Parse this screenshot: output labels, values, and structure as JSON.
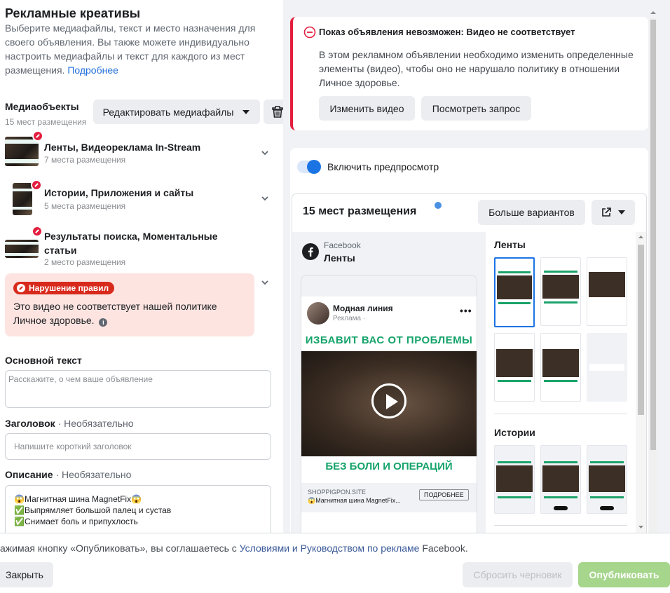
{
  "creatives": {
    "title": "Рекламные креативы",
    "intro": "Выберите медиафайлы, текст и место назначения для своего объявления. Вы также можете индивидуально настроить медиафайлы и текст для каждого из мест размещения.",
    "learn_more": "Подробнее",
    "media_label": "Медиаобъекты",
    "media_sub": "15 мест размещения",
    "edit_media": "Редактировать медиафайлы",
    "groups": [
      {
        "title": "Ленты, Видеореклама In-Stream",
        "sub": "7 места размещения"
      },
      {
        "title": "Истории, Приложения и сайты",
        "sub": "5 места размещения"
      },
      {
        "title": "Результаты поиска, Моментальные статьи",
        "sub": "2 место размещения"
      }
    ],
    "violation_badge": "Нарушение правил",
    "violation_text": "Это видео не соответствует нашей политике Личное здоровье.",
    "primary_text_label": "Основной текст",
    "primary_text_placeholder": "Расскажите, о чем ваше объявление",
    "headline_label": "Заголовок",
    "optional": "· Необязательно",
    "headline_placeholder": "Напишите короткий заголовок",
    "description_label": "Описание",
    "description_lines": [
      "😱Магнитная шина MagnetFix😱",
      "✅Выпрямляет большой палец и сустав",
      "✅Снимает боль и припухлость"
    ]
  },
  "alert": {
    "title": "Показ объявления невозможен: Видео не соответствует",
    "body": "В этом рекламном объявлении необходимо изменить определенные элементы (видео), чтобы оно не нарушало политику в отношении Личное здоровье.",
    "change_video": "Изменить видео",
    "view_request": "Посмотреть запрос"
  },
  "preview": {
    "toggle_label": "Включить предпросмотр",
    "toggle_on": true,
    "placements_title": "15 мест размещения",
    "more_options": "Больше вариантов",
    "network": "Facebook",
    "placement": "Ленты",
    "page_name": "Модная линия",
    "sponsored": "Реклама ·",
    "headline_top": "ИЗБАВИТ ВАС ОТ ПРОБЛЕМЫ",
    "headline_bottom": "БЕЗ БОЛИ И ОПЕРАЦИЙ",
    "domain": "SHOPPIGPON.SITE",
    "link_desc": "😱Магнитная шина MagnetFix...",
    "cta": "ПОДРОБНЕЕ",
    "feeds_label": "Ленты",
    "stories_label": "Истории"
  },
  "footer": {
    "terms_prefix": "ажимая кнопку «Опубликовать», вы соглашаетесь с",
    "terms_link": "Условиями и Руководством по рекламе",
    "terms_suffix": "Facebook.",
    "close": "Закрыть",
    "discard": "Сбросить черновик",
    "publish": "Опубликовать"
  },
  "colors": {
    "accent": "#1b74e4",
    "error": "#e41e3f",
    "violation_bg": "#fde4e1",
    "publish_disabled": "#a6d58c",
    "ad_green": "#14a36a"
  }
}
